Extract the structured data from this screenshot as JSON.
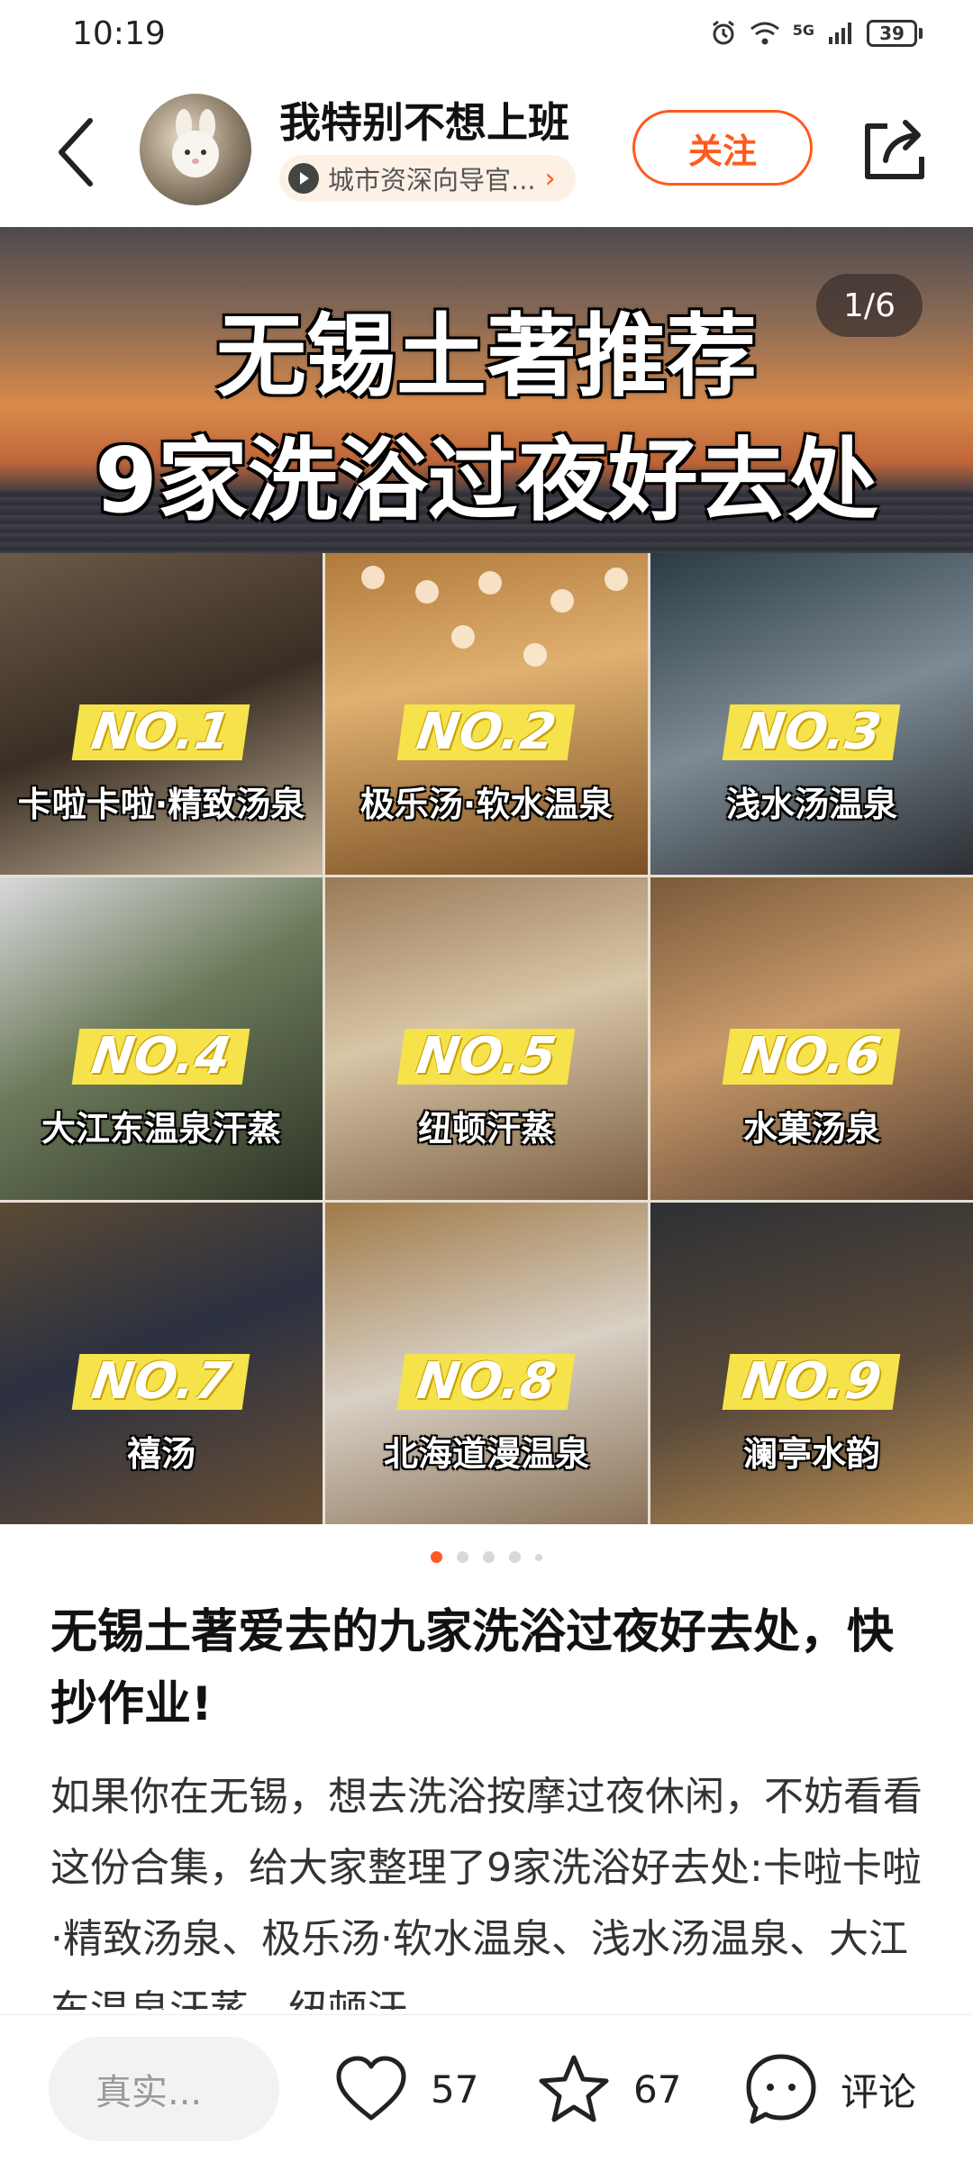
{
  "status_bar": {
    "time": "10:19",
    "network": "5G",
    "battery": "39"
  },
  "header": {
    "author_name": "我特别不想上班",
    "author_tag": "城市资深向导官...",
    "follow_label": "关注"
  },
  "hero": {
    "title_line1": "无锡土著推荐",
    "title_line2": "9家洗浴过夜好去处",
    "page_indicator": "1/6",
    "tiles": [
      {
        "no": "NO.1",
        "name": "卡啦卡啦·精致汤泉"
      },
      {
        "no": "NO.2",
        "name": "极乐汤·软水温泉"
      },
      {
        "no": "NO.3",
        "name": "浅水汤温泉"
      },
      {
        "no": "NO.4",
        "name": "大江东温泉汗蒸"
      },
      {
        "no": "NO.5",
        "name": "纽顿汗蒸"
      },
      {
        "no": "NO.6",
        "name": "水菓汤泉"
      },
      {
        "no": "NO.7",
        "name": "禧汤"
      },
      {
        "no": "NO.8",
        "name": "北海道漫温泉"
      },
      {
        "no": "NO.9",
        "name": "澜亭水韵"
      }
    ]
  },
  "carousel": {
    "total_dots": 5,
    "active_index": 0
  },
  "post": {
    "title": "无锡土著爱去的九家洗浴过夜好去处，快抄作业!",
    "body": "如果你在无锡，想去洗浴按摩过夜休闲，不妨看看这份合集，给大家整理了9家洗浴好去处:卡啦卡啦·精致汤泉、极乐汤·软水温泉、浅水汤温泉、大江东温泉汗蒸、纽顿汗"
  },
  "bottom_bar": {
    "comment_placeholder": "真实...",
    "like_count": "57",
    "collect_count": "67",
    "comment_label": "评论"
  },
  "colors": {
    "accent": "#ff5a1f",
    "badge_yellow": "#f6e24b"
  },
  "icons": {
    "back": "back-arrow-icon",
    "share": "share-icon",
    "like": "heart-icon",
    "collect": "star-icon",
    "comment": "comment-bubble-icon"
  }
}
